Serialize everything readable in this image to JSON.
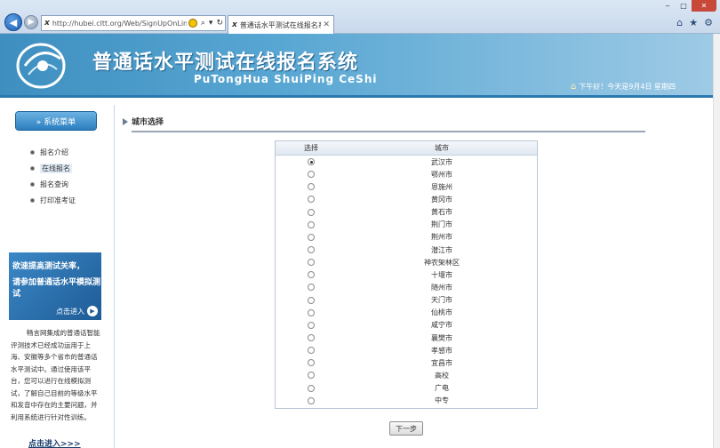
{
  "browser": {
    "url": "http://hubei.cltt.org/Web/SignUpOnLine/Sir",
    "tab_title": "普通话水平测试在线报名系...",
    "tab_icon": "ie-site-icon"
  },
  "header": {
    "title": "普通话水平测试在线报名系统",
    "subtitle": "PuTongHua ShuiPing CeShi",
    "greeting": "下午好！今天是9月4日 星期四"
  },
  "sidebar": {
    "menu_title": "系统菜单",
    "items": [
      {
        "label": "报名介绍",
        "active": false
      },
      {
        "label": "在线报名",
        "active": true
      },
      {
        "label": "报名查询",
        "active": false
      },
      {
        "label": "打印准考证",
        "active": false
      }
    ],
    "promo": {
      "line1": "欲速提高测试关率，",
      "line2": "请参加普通话水平模拟测试",
      "link": "点击进入"
    },
    "description": "畅言网集成的普通话智能评测技术已经成功运用于上海、安徽等多个省市的普通话水平测试中。通过使用该平台，您可以进行在线模拟测试，了解自己目前的等级水平和发音中存在的主要问题，并利用系统进行针对性训练。",
    "more_link": "点击进入>>>"
  },
  "main": {
    "section_title": "城市选择",
    "columns": [
      "选择",
      "城市"
    ],
    "cities": [
      {
        "name": "武汉市",
        "selected": true
      },
      {
        "name": "鄂州市",
        "selected": false
      },
      {
        "name": "恩施州",
        "selected": false
      },
      {
        "name": "黄冈市",
        "selected": false
      },
      {
        "name": "黄石市",
        "selected": false
      },
      {
        "name": "荆门市",
        "selected": false
      },
      {
        "name": "荆州市",
        "selected": false
      },
      {
        "name": "潜江市",
        "selected": false
      },
      {
        "name": "神农架林区",
        "selected": false
      },
      {
        "name": "十堰市",
        "selected": false
      },
      {
        "name": "随州市",
        "selected": false
      },
      {
        "name": "天门市",
        "selected": false
      },
      {
        "name": "仙桃市",
        "selected": false
      },
      {
        "name": "咸宁市",
        "selected": false
      },
      {
        "name": "襄樊市",
        "selected": false
      },
      {
        "name": "孝感市",
        "selected": false
      },
      {
        "name": "宜昌市",
        "selected": false
      },
      {
        "name": "高校",
        "selected": false
      },
      {
        "name": "广电",
        "selected": false
      },
      {
        "name": "中专",
        "selected": false
      }
    ],
    "next_label": "下一步"
  },
  "colors": {
    "banner_start": "#3e8fc0",
    "banner_end": "#9fcbe6",
    "menu_head": "#2b7ec0"
  }
}
